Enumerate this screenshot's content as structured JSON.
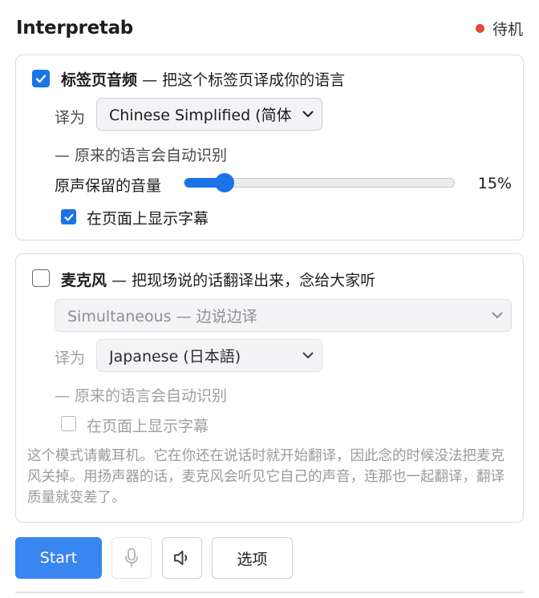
{
  "app": {
    "title": "Interpretab",
    "status": "待机",
    "status_color": "#e5483b"
  },
  "tab_audio": {
    "enabled": true,
    "title": "标签页音频",
    "description": "— 把这个标签页译成你的语言",
    "translate_label": "译为",
    "target_language": "Chinese Simplified (简体",
    "auto_detect_note": "— 原来的语言会自动识别",
    "volume_label": "原声保留的音量",
    "volume_value": "15%",
    "volume_fraction": 0.15,
    "subtitles_enabled": true,
    "subtitles_label": "在页面上显示字幕"
  },
  "microphone": {
    "enabled": false,
    "title": "麦克风",
    "description": "— 把现场说的话翻译出来，念给大家听",
    "mode": "Simultaneous — 边说边译",
    "translate_label": "译为",
    "target_language": "Japanese (日本語)",
    "auto_detect_note": "— 原来的语言会自动识别",
    "subtitles_enabled": false,
    "subtitles_label": "在页面上显示字幕",
    "note": "这个模式请戴耳机。它在你还在说话时就开始翻译，因此念的时候没法把麦克风关掉。用扬声器的话，麦克风会听见它自己的声音，连那也一起翻译，翻译质量就变差了。"
  },
  "toolbar": {
    "start_label": "Start",
    "mic_icon": "microphone-icon",
    "speaker_icon": "speaker-icon",
    "options_label": "选项",
    "accent_color": "#3a86f0"
  }
}
